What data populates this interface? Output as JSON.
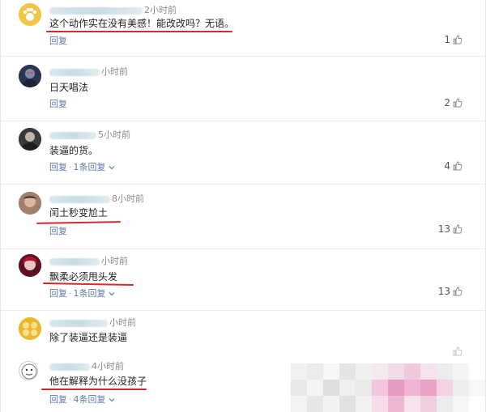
{
  "comments": [
    {
      "time": "2小时前",
      "text": "这个动作实在没有美感！能改改吗？无语。",
      "reply": "回复",
      "likes": "1",
      "thread": ""
    },
    {
      "time": "小时前",
      "text": "日天唱法",
      "reply": "回复",
      "likes": "2",
      "thread": ""
    },
    {
      "time": "5小时前",
      "text": "装逼的货。",
      "reply": "回复",
      "likes": "4",
      "thread": "1条回复"
    },
    {
      "time": "8小时前",
      "text": "闰土秒变尬土",
      "reply": "回复",
      "likes": "13",
      "thread": ""
    },
    {
      "time": "小时前",
      "text": "飘柔必须甩头发",
      "reply": "回复",
      "likes": "13",
      "thread": "1条回复"
    },
    {
      "time": "小时前",
      "text": "除了装逼还是装逼",
      "reply": "",
      "likes": "",
      "thread": ""
    },
    {
      "time": "4小时前",
      "text": "他在解释为什么没孩子",
      "reply": "回复",
      "likes": "",
      "thread": "4条回复"
    }
  ],
  "icons": {
    "like": "thumbs-up-icon",
    "expand": "chevron-down-icon"
  },
  "colors": {
    "underline": "#d12b2b",
    "link": "#5d7aa8"
  }
}
